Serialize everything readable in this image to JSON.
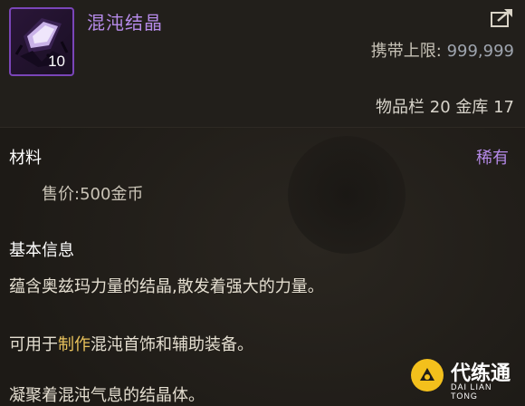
{
  "item": {
    "name": "混沌结晶",
    "quantity": "10",
    "carry_limit_label": "携带上限:",
    "carry_limit_value": "999,999",
    "storage": "物品栏 20 金库 17"
  },
  "materials": {
    "title": "材料",
    "rarity": "稀有",
    "price": "售价:500金币"
  },
  "info": {
    "title": "基本信息",
    "line1": "蕴含奥兹玛力量的结晶,散发着强大的力量。",
    "line2_prefix": "可用于",
    "line2_highlight": "制作",
    "line2_suffix": "混沌首饰和辅助装备。",
    "line3": "凝聚着混沌气息的结晶体。"
  },
  "watermark": {
    "text": "代练通",
    "sub": "DAI LIAN TONG"
  },
  "colors": {
    "rare_purple": "#b58ae8",
    "highlight_gold": "#e8c25c",
    "icon_border": "#7a45b8"
  },
  "icons": [
    "crystal-item-icon",
    "share-icon",
    "watermark-logo-icon"
  ]
}
